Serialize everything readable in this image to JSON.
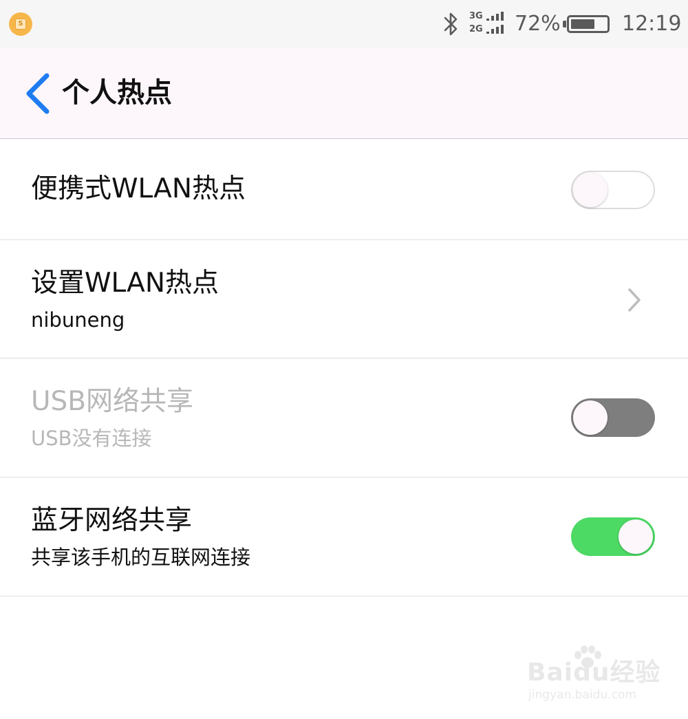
{
  "status_bar": {
    "network_top": "3G",
    "network_bottom": "2G",
    "battery_percent": "72%",
    "battery_level": 0.72,
    "time": "12:19",
    "icons": [
      "app-notification-icon",
      "bluetooth-icon",
      "signal-icon",
      "battery-icon"
    ]
  },
  "header": {
    "title": "个人热点",
    "back_icon": "back-chevron-icon",
    "accent": "#1e7cf0"
  },
  "rows": [
    {
      "title": "便携式WLAN热点",
      "control": "toggle",
      "state": "off"
    },
    {
      "title": "设置WLAN热点",
      "subtitle": "nibuneng",
      "control": "chevron-right-icon"
    },
    {
      "title": "USB网络共享",
      "subtitle": "USB没有连接",
      "control": "toggle",
      "state": "off",
      "enabled": false
    },
    {
      "title": "蓝牙网络共享",
      "subtitle": "共享该手机的互联网连接",
      "control": "toggle",
      "state": "on",
      "on_color": "#4cd964"
    }
  ],
  "watermark": {
    "brand": "Baidu经验",
    "url": "jingyan.baidu.com"
  }
}
